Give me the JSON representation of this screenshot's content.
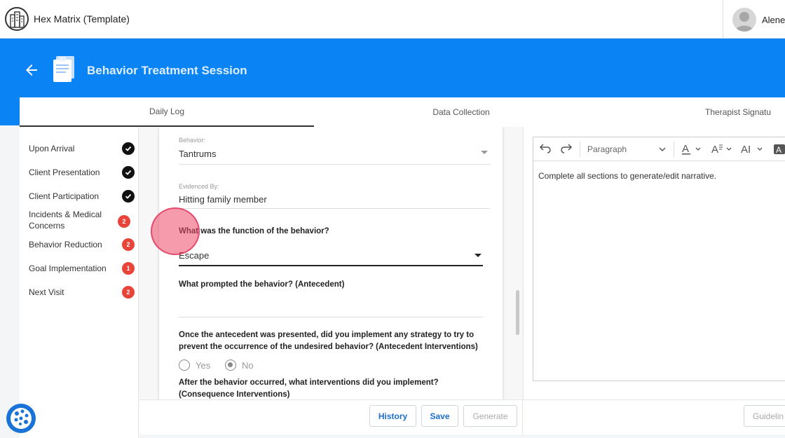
{
  "app": {
    "title": "Hex Matrix (Template)",
    "user_name": "Alene"
  },
  "header": {
    "title": "Behavior Treatment Session"
  },
  "tabs": [
    {
      "label": "Daily Log",
      "active": true
    },
    {
      "label": "Data Collection",
      "active": false
    },
    {
      "label": "Therapist Signatu",
      "active": false
    }
  ],
  "sidebar": {
    "items": [
      {
        "label": "Upon Arrival",
        "status": "complete",
        "badge": ""
      },
      {
        "label": "Client Presentation",
        "status": "complete",
        "badge": ""
      },
      {
        "label": "Client Participation",
        "status": "complete",
        "badge": ""
      },
      {
        "label": "Incidents & Medical Concerns",
        "status": "count",
        "badge": "2"
      },
      {
        "label": "Behavior Reduction",
        "status": "count",
        "badge": "2"
      },
      {
        "label": "Goal Implementation",
        "status": "count",
        "badge": "1"
      },
      {
        "label": "Next Visit",
        "status": "count",
        "badge": "2"
      }
    ]
  },
  "form": {
    "behavior_label": "Behavior:",
    "behavior_value": "Tantrums",
    "evidenced_label": "Evidenced By:",
    "evidenced_value": "Hitting family member",
    "q_function": "What was the function of the behavior?",
    "function_value": "Escape",
    "q_antecedent": "What prompted the behavior? (Antecedent)",
    "antecedent_value": "",
    "q_antecedent_intervention_line1": "Once the antecedent was presented, did you implement any strategy to try to",
    "q_antecedent_intervention_line2": "prevent the occurrence of the undesired behavior? (Antecedent Interventions)",
    "radio_yes": "Yes",
    "radio_no": "No",
    "radio_selected": "No",
    "q_consequence_line1": "After the behavior occurred, what interventions did you implement?",
    "q_consequence_line2": "(Consequence Interventions)"
  },
  "editor": {
    "paragraph_label": "Paragraph",
    "narrative_text": "Complete all sections to generate/edit narrative."
  },
  "actions": {
    "history": "History",
    "save": "Save",
    "generate": "Generate",
    "guidelines": "Guidelin"
  },
  "colors": {
    "brand_blue": "#0a83f5",
    "badge_red": "#e8443a",
    "link_blue": "#1b6fd0"
  },
  "icons": {
    "logo": "building-icon",
    "back": "arrow-left-icon",
    "document": "document-icon",
    "complete": "check-circle-icon",
    "undo": "undo-icon",
    "redo": "redo-icon",
    "accessibility": "accessibility-icon"
  }
}
